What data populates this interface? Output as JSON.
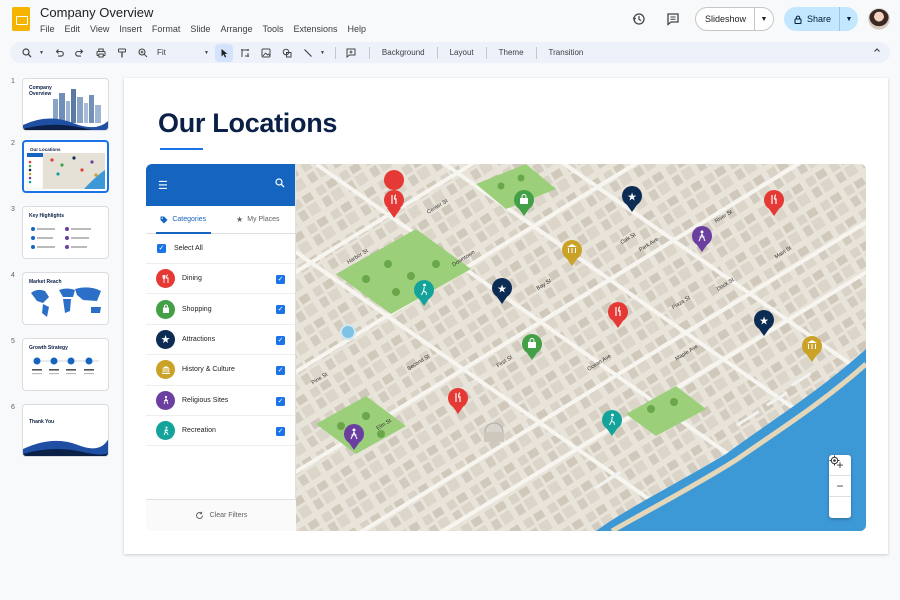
{
  "app": {
    "doc_title": "Company Overview",
    "menu": [
      "File",
      "Edit",
      "View",
      "Insert",
      "Format",
      "Slide",
      "Arrange",
      "Tools",
      "Extensions",
      "Help"
    ],
    "slideshow_label": "Slideshow",
    "share_label": "Share"
  },
  "toolbar": {
    "zoom_value": "Fit",
    "background_label": "Background",
    "layout_label": "Layout",
    "theme_label": "Theme",
    "transition_label": "Transition"
  },
  "filmstrip": {
    "slides": [
      {
        "num": "1",
        "title": "Company Overview"
      },
      {
        "num": "2",
        "title": "Our Locations"
      },
      {
        "num": "3",
        "title": "Key Highlights"
      },
      {
        "num": "4",
        "title": "Market Reach"
      },
      {
        "num": "5",
        "title": "Growth Strategy"
      },
      {
        "num": "6",
        "title": "Thank You"
      }
    ],
    "selected_index": 1
  },
  "slide": {
    "title": "Our Locations",
    "sidebar": {
      "tab_categories": "Categories",
      "tab_my_places": "My Places",
      "select_all": "Select All",
      "categories": [
        {
          "label": "Dining",
          "color": "#e53935",
          "icon": "fork-knife-icon",
          "checked": true
        },
        {
          "label": "Shopping",
          "color": "#43a047",
          "icon": "shopping-bag-icon",
          "checked": true
        },
        {
          "label": "Attractions",
          "color": "#0d2c54",
          "icon": "star-icon",
          "checked": true
        },
        {
          "label": "History & Culture",
          "color": "#c9a227",
          "icon": "museum-icon",
          "checked": true
        },
        {
          "label": "Religious Sites",
          "color": "#6a3fa0",
          "icon": "praying-hands-icon",
          "checked": true
        },
        {
          "label": "Recreation",
          "color": "#14a39a",
          "icon": "hiker-icon",
          "checked": true
        }
      ],
      "clear_filters": "Clear Filters"
    },
    "map": {
      "streets": [
        "Harbor St",
        "Center St",
        "Bay St",
        "Downtown",
        "Park Ave",
        "Main St",
        "River St",
        "Pine St",
        "First St",
        "Ocean Ave",
        "Plaza St",
        "Elm St",
        "Second St",
        "Maple Ave",
        "Dock St",
        "Oak St"
      ],
      "zoom_in": "+",
      "zoom_out": "−"
    }
  }
}
